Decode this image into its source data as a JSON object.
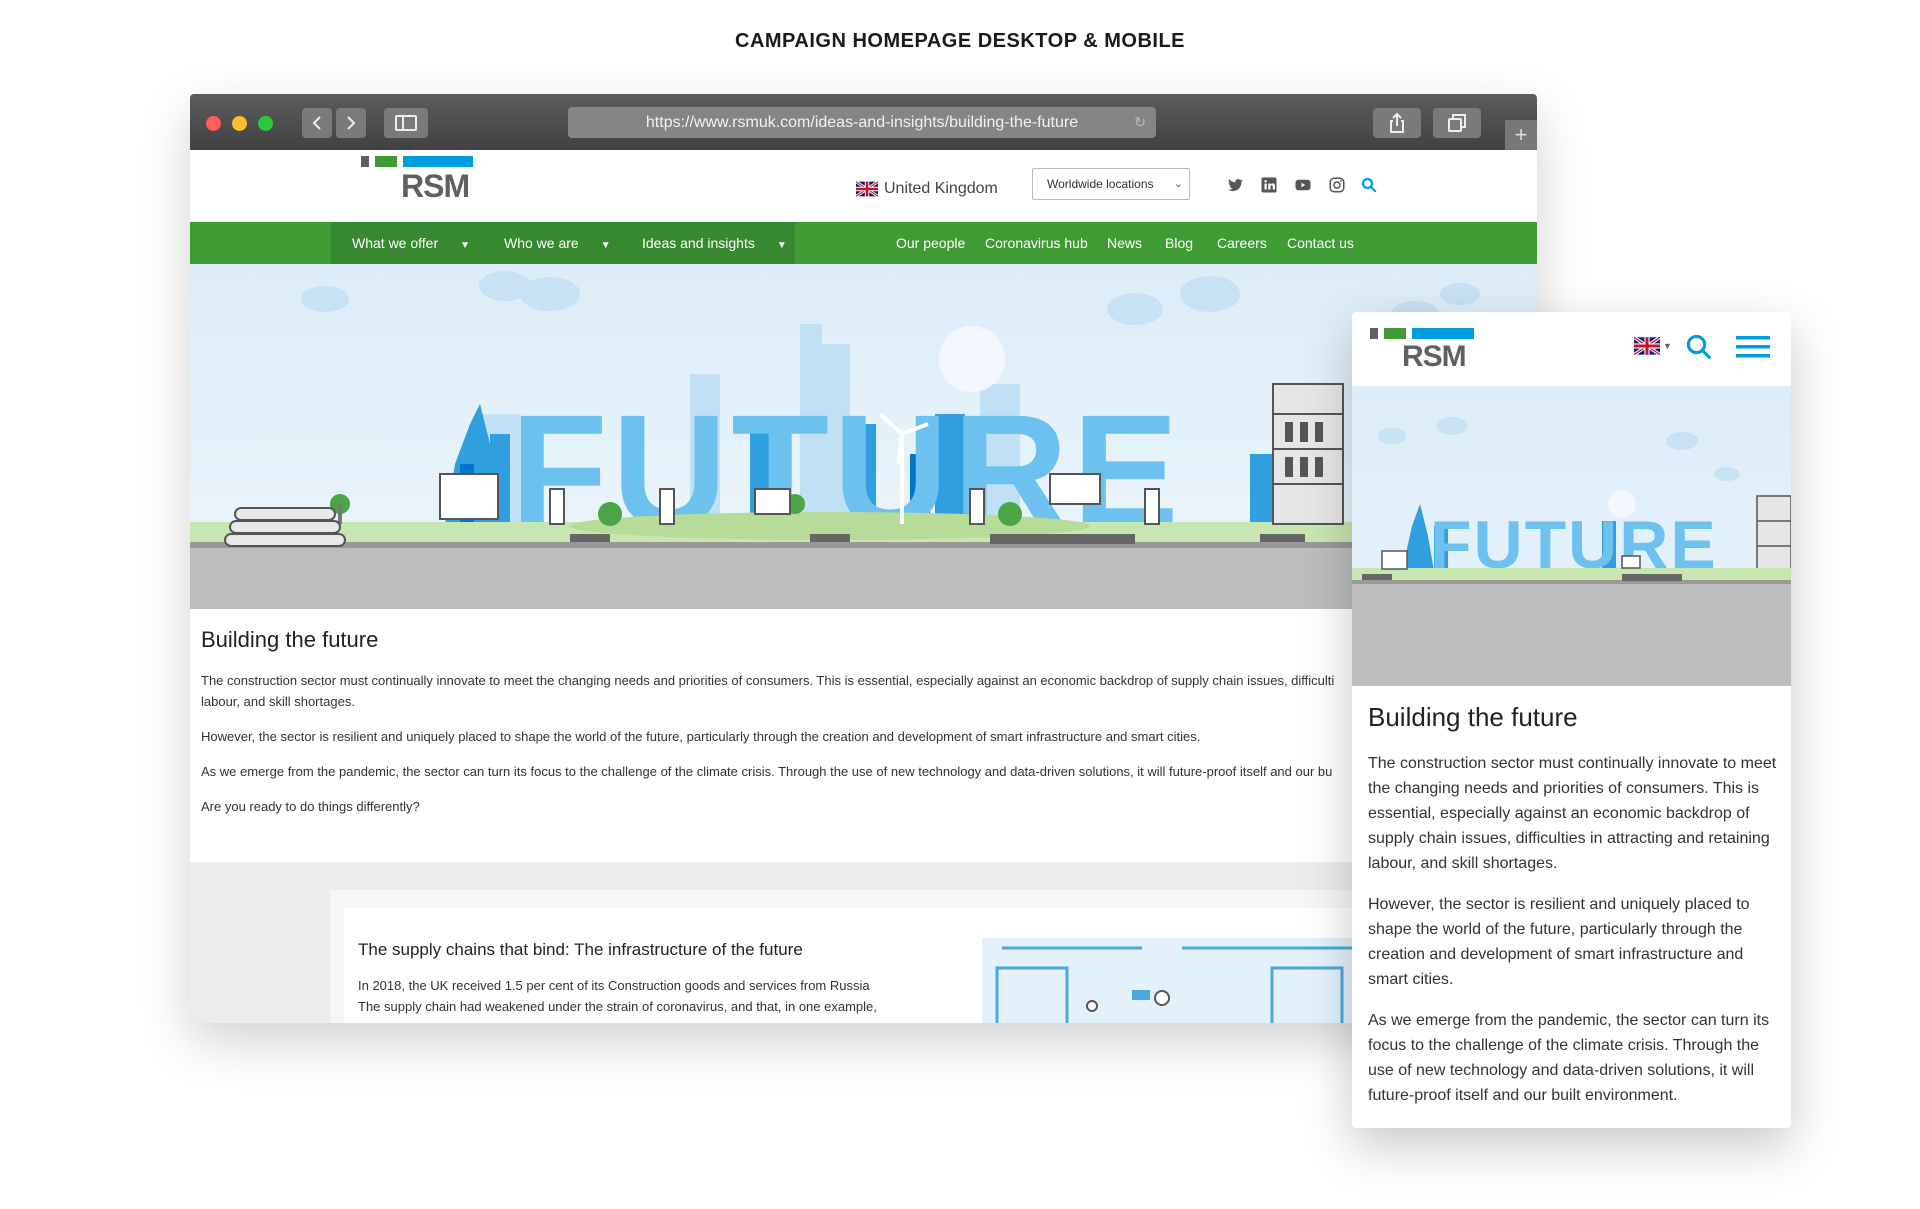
{
  "page": {
    "title": "CAMPAIGN HOMEPAGE DESKTOP & MOBILE"
  },
  "browser": {
    "url": "https://www.rsmuk.com/ideas-and-insights/building-the-future",
    "new_tab_label": "+"
  },
  "site": {
    "logo_text": "RSM",
    "country": "United Kingdom",
    "locations_select": "Worldwide locations",
    "nav_left": [
      {
        "label": "What we offer"
      },
      {
        "label": "Who we are"
      },
      {
        "label": "Ideas and insights"
      }
    ],
    "nav_right": [
      {
        "label": "Our people"
      },
      {
        "label": "Coronavirus hub"
      },
      {
        "label": "News"
      },
      {
        "label": "Blog"
      },
      {
        "label": "Careers"
      },
      {
        "label": "Contact us"
      }
    ],
    "hero_word": "FUTURE",
    "article": {
      "title": "Building the future",
      "paragraphs": [
        "The construction sector must continually innovate to meet the changing needs and priorities of consumers. This is essential, especially against an economic backdrop of supply chain issues, difficulti",
        "labour, and skill shortages.",
        "However, the sector is resilient and uniquely placed to shape the world of the future, particularly through the creation and development of smart infrastructure and smart cities.",
        "As we emerge from the pandemic, the sector can turn its focus to the challenge of the climate crisis. Through the use of new technology and data-driven solutions, it will future-proof itself and our bu",
        "Are you ready to do things differently?"
      ]
    },
    "card": {
      "title": "The supply chains that bind: The infrastructure of the future",
      "line1": "In 2018, the UK received 1.5 per cent of its Construction goods and services from Russia",
      "line2": "The supply chain had weakened under the strain of coronavirus, and that, in one example,"
    }
  },
  "mobile": {
    "logo_text": "RSM",
    "hero_word": "FUTURE",
    "title": "Building the future",
    "paragraphs": [
      "The construction sector must continually innovate to meet the changing needs and priorities of consumers. This is essential, especially against an economic backdrop of supply chain issues, difficulties in attracting and retaining labour, and skill shortages.",
      "However, the sector is resilient and uniquely placed to shape the world of the future, particularly through the creation and development of smart infrastructure and smart cities.",
      "As we emerge from the pandemic, the sector can turn its focus to the challenge of the climate crisis. Through the use of new technology and data-driven solutions, it will future-proof itself and our built environment."
    ]
  },
  "colors": {
    "rsm_green": "#3f9c35",
    "rsm_blue": "#009cde",
    "rsm_grey": "#5f6062"
  }
}
